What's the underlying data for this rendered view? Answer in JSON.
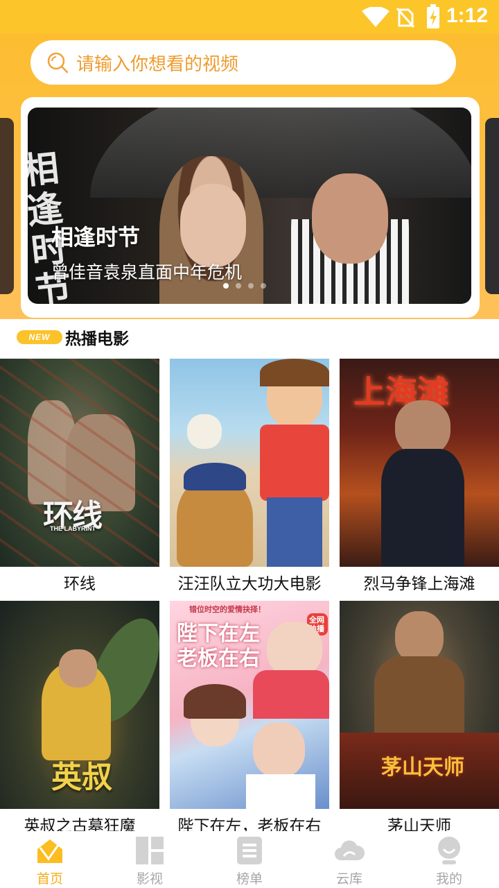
{
  "status_bar": {
    "time": "1:12"
  },
  "search": {
    "placeholder": "请输入你想看的视频"
  },
  "banner": {
    "title": "相逢时节",
    "subtitle": "曾佳音袁泉直面中年危机",
    "calligraphy": "相逢时节",
    "dot_count": 4,
    "active_dot": 0
  },
  "section": {
    "badge": "NEW",
    "title": "热播电影"
  },
  "movies": [
    {
      "title": "环线",
      "poster_text": "环线",
      "poster_sub": "THE LABYRINT"
    },
    {
      "title": "汪汪队立大功大电影"
    },
    {
      "title": "烈马争锋上海滩",
      "poster_text": "上海滩"
    },
    {
      "title": "英叔之古墓狂魔",
      "poster_text": "英叔"
    },
    {
      "title": "陛下在左，老板在右",
      "poster_text": "陛下在左 老板在右",
      "poster_top": "错位时空的爱情抉择！",
      "poster_badge": "全网独播"
    },
    {
      "title": "茅山天师",
      "poster_text": "茅山天师"
    }
  ],
  "nav": [
    {
      "label": "首页",
      "icon": "home-icon",
      "active": true
    },
    {
      "label": "影视",
      "icon": "grid-icon",
      "active": false
    },
    {
      "label": "榜单",
      "icon": "list-icon",
      "active": false
    },
    {
      "label": "云库",
      "icon": "cloud-icon",
      "active": false
    },
    {
      "label": "我的",
      "icon": "profile-icon",
      "active": false
    }
  ],
  "colors": {
    "accent": "#fcc22a",
    "active_nav": "#f6ad1b",
    "placeholder": "#ee9c2e"
  }
}
